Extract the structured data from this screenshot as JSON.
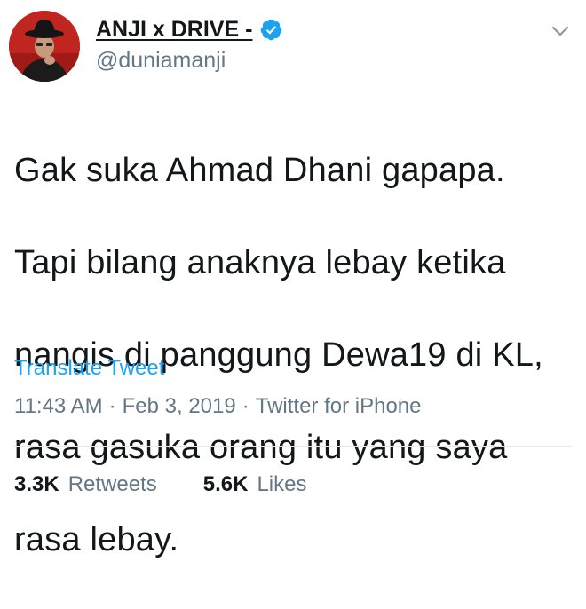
{
  "author": {
    "display_name": "ANJI x DRIVE -",
    "handle": "@duniamanji",
    "verified_color": "#1da1f2"
  },
  "tweet": {
    "lines": [
      "Gak suka Ahmad Dhani gapapa.",
      "Tapi bilang anaknya lebay ketika",
      "nangis di panggung Dewa19 di KL,",
      "rasa gasuka orang itu yang saya",
      "rasa lebay."
    ],
    "translate_label": "Translate Tweet",
    "time": "11:43 AM",
    "date": "Feb 3, 2019",
    "source": "Twitter for iPhone",
    "meta_separator": "·"
  },
  "stats": {
    "retweets_count": "3.3K",
    "retweets_label": "Retweets",
    "likes_count": "5.6K",
    "likes_label": "Likes"
  },
  "icons": {
    "verified": "verified-badge-icon",
    "menu": "chevron-down-icon"
  },
  "colors": {
    "accent": "#1da1f2",
    "text": "#14171a",
    "secondary_text": "#657786",
    "divider": "#e1e8ed"
  }
}
